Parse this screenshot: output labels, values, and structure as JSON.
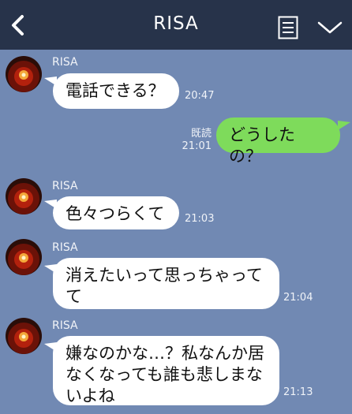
{
  "header": {
    "title": "RISA",
    "back_icon": "chevron-left-icon",
    "notes_icon": "notes-icon",
    "menu_icon": "chevron-down-icon"
  },
  "messages": [
    {
      "sender": "RISA",
      "text": "電話できる？",
      "time": "20:47"
    },
    {
      "text": "どうしたの？",
      "read_label": "既読",
      "time": "21:01"
    },
    {
      "sender": "RISA",
      "text": "色々つらくて",
      "time": "21:03"
    },
    {
      "sender": "RISA",
      "lines": [
        "消えたいって思っちゃって",
        "て"
      ],
      "time": "21:04"
    },
    {
      "sender": "RISA",
      "lines": [
        "嫌なのかな…？私なんか居",
        "なくなっても誰も悲しまな",
        "いよね"
      ],
      "time": "21:13"
    }
  ]
}
